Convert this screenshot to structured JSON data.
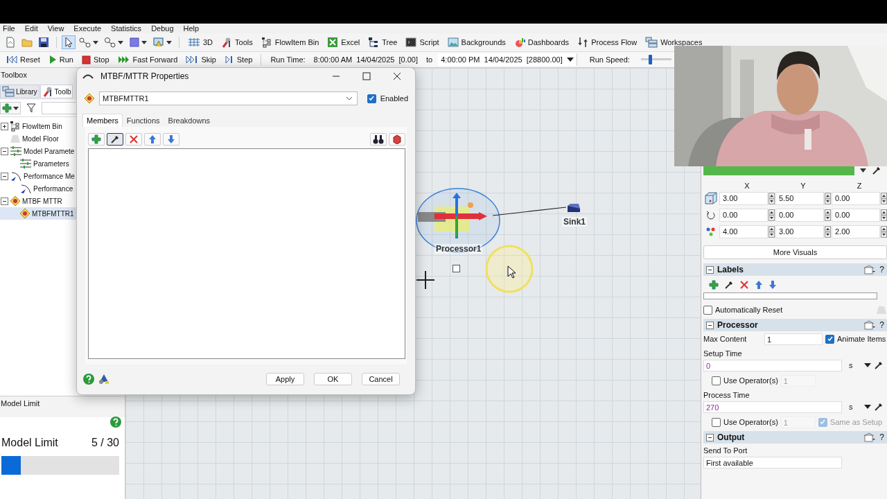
{
  "menu": [
    "File",
    "Edit",
    "View",
    "Execute",
    "Statistics",
    "Debug",
    "Help"
  ],
  "tool_buttons": [
    {
      "selected": false
    },
    {
      "selected": false
    },
    {
      "selected": false
    },
    {
      "selected": true
    },
    {
      "selected": false
    },
    {
      "selected": false
    },
    {
      "selected": false
    },
    {
      "selected": false
    }
  ],
  "toolbar_buttons": [
    "3D",
    "Tools",
    "FlowItem Bin",
    "Excel",
    "Tree",
    "Script",
    "Backgrounds",
    "Dashboards",
    "Process Flow",
    "Workspaces"
  ],
  "run_controls": [
    "Reset",
    "Run",
    "Stop",
    "Fast Forward",
    "Skip",
    "Step"
  ],
  "run_time": {
    "label": "Run Time:",
    "start": "8:00:00 AM  14/04/2025  [0.00]",
    "to": "to",
    "end": "4:00:00 PM  14/04/2025  [28800.00]"
  },
  "run_speed": {
    "label": "Run Speed:",
    "level": 0.28
  },
  "toolbox": {
    "title": "Toolbox",
    "tabs": [
      {
        "label": "Library",
        "selected": false
      },
      {
        "label": "Toolb",
        "selected": true
      }
    ],
    "tree": [
      {
        "label": "FlowItem Bin",
        "kind": "group",
        "expanded": false,
        "selected": false
      },
      {
        "label": "Model Floor",
        "kind": "leaf",
        "selected": false
      },
      {
        "label": "Model Paramete",
        "kind": "group",
        "expanded": true,
        "selected": false,
        "children": [
          {
            "label": "Parameters",
            "kind": "leaf",
            "selected": false
          }
        ]
      },
      {
        "label": "Performance Me",
        "kind": "group",
        "expanded": true,
        "selected": false,
        "children": [
          {
            "label": "Performance",
            "kind": "leaf",
            "selected": false
          }
        ]
      },
      {
        "label": "MTBF MTTR",
        "kind": "group",
        "expanded": true,
        "selected": false,
        "children": [
          {
            "label": "MTBFMTTR1",
            "kind": "leaf",
            "selected": true
          }
        ]
      }
    ]
  },
  "model_limit": {
    "header": "Model Limit",
    "label": "Model Limit",
    "count": "5 / 30",
    "level": 0.167
  },
  "dialog": {
    "title": "MTBF/MTTR Properties",
    "object": "MTBFMTTR1",
    "enabled": {
      "label": "Enabled",
      "checked": true
    },
    "tabs": [
      {
        "label": "Members",
        "selected": true
      },
      {
        "label": "Functions",
        "selected": false
      },
      {
        "label": "Breakdowns",
        "selected": false
      }
    ],
    "member_tools": [
      {
        "selected": false
      },
      {
        "selected": true
      },
      {
        "selected": false
      },
      {
        "selected": false
      },
      {
        "selected": false
      }
    ],
    "buttons": [
      "Apply",
      "OK",
      "Cancel"
    ]
  },
  "canvas": {
    "objects": [
      {
        "kind": "processor",
        "label": "Processor1",
        "selected": true
      },
      {
        "kind": "sink",
        "label": "Sink1",
        "selected": false
      }
    ]
  },
  "webcam": {
    "kind": "picture"
  },
  "properties": {
    "axes": [
      "X",
      "Y",
      "Z"
    ],
    "rows": [
      {
        "values": [
          "3.00",
          "5.50",
          "0.00"
        ]
      },
      {
        "values": [
          "0.00",
          "0.00",
          "0.00"
        ]
      },
      {
        "values": [
          "4.00",
          "3.00",
          "2.00"
        ]
      }
    ],
    "more_visuals": "More Visuals",
    "labels": {
      "title": "Labels",
      "help": "?",
      "expanded": true,
      "auto_reset": {
        "label": "Automatically Reset",
        "checked": false
      }
    },
    "processor": {
      "title": "Processor",
      "help": "?",
      "expanded": true,
      "max_content": {
        "label": "Max Content",
        "value": "1"
      },
      "animate_items": {
        "label": "Animate Items",
        "checked": true
      },
      "setup_time": {
        "label": "Setup Time",
        "value": "0",
        "unit": "s",
        "use_operators": {
          "label": "Use Operator(s)",
          "checked": false,
          "count": "1"
        }
      },
      "process_time": {
        "label": "Process Time",
        "value": "270",
        "unit": "s",
        "use_operators": {
          "label": "Use Operator(s)",
          "checked": false,
          "count": "1"
        },
        "same_as_setup": {
          "label": "Same as Setup",
          "checked": true,
          "disabled": true
        }
      }
    },
    "output": {
      "title": "Output",
      "help": "?",
      "expanded": true,
      "send_to_port": {
        "label": "Send To Port",
        "value": "First available"
      }
    }
  }
}
